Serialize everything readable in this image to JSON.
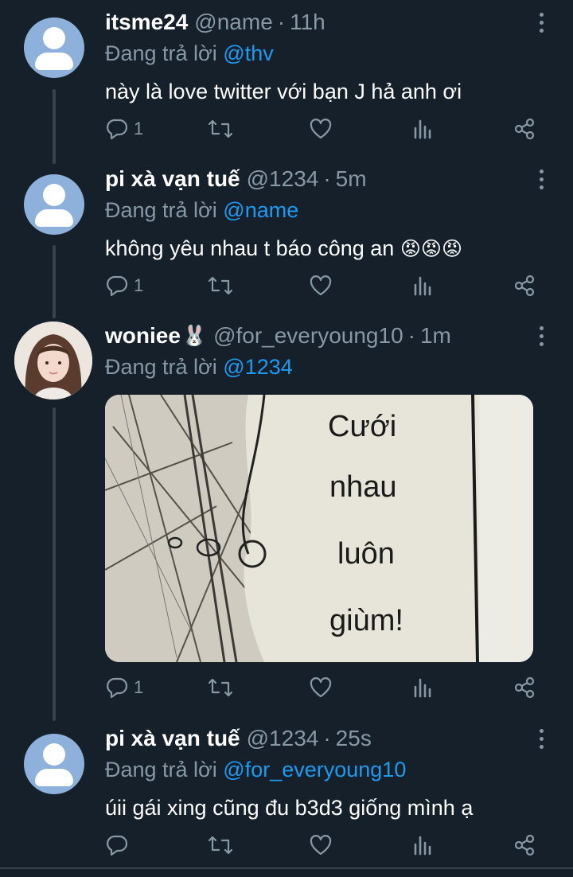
{
  "tweets": [
    {
      "name": "itsme24",
      "handle": "@name",
      "separator": "·",
      "time": "11h",
      "reply_prefix": "Đang trả lời",
      "reply_mention": "@thv",
      "text": "này là love twitter với bạn J hả anh ơi",
      "reply_count": "1",
      "avatar_icon": "default-avatar-icon"
    },
    {
      "name": "pi xà vạn tuế",
      "handle": "@1234",
      "separator": "·",
      "time": "5m",
      "reply_prefix": "Đang trả lời",
      "reply_mention": "@name",
      "text": "không yêu nhau t báo công an",
      "emoji": "😡😡😡",
      "reply_count": "1",
      "avatar_icon": "default-avatar-icon"
    },
    {
      "name": "woniee",
      "name_emoji": "🐰",
      "handle": "@for_everyoung10",
      "separator": "·",
      "time": "1m",
      "reply_prefix": "Đang trả lời",
      "reply_mention": "@1234",
      "media_text_lines": [
        "Cưới",
        "nhau",
        "luôn",
        "giùm!"
      ],
      "reply_count": "1",
      "avatar_icon": "profile-photo"
    },
    {
      "name": "pi xà vạn tuế",
      "handle": "@1234",
      "separator": "·",
      "time": "25s",
      "reply_prefix": "Đang trả lời",
      "reply_mention": "@for_everyoung10",
      "text": "úii gái xing cũng đu b3d3 giống mình ạ",
      "reply_count": "",
      "avatar_icon": "default-avatar-icon"
    }
  ],
  "colors": {
    "background": "#15202b",
    "text": "#ffffff",
    "secondary": "#8899a6",
    "accent": "#1d9bf0",
    "thread_line": "#38444d"
  },
  "action_icons": [
    "reply-icon",
    "retweet-icon",
    "like-icon",
    "analytics-icon",
    "share-icon"
  ]
}
